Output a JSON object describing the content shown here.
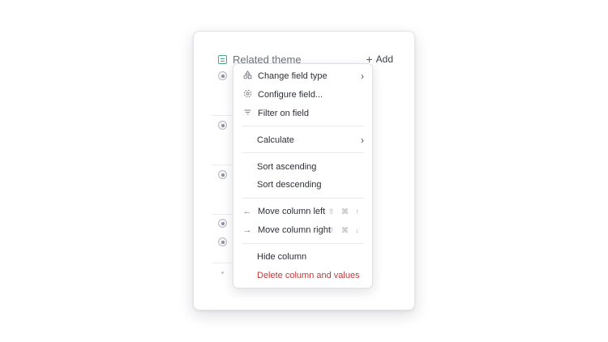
{
  "card": {
    "title": "Related theme",
    "add_label": "Add",
    "add_icon": "plus-icon",
    "title_icon": "list-icon",
    "accent": "#4aa88a"
  },
  "menu": {
    "items": [
      {
        "label": "Change field type",
        "icon": "shapes-icon",
        "submenu": true
      },
      {
        "label": "Configure field...",
        "icon": "gear-icon"
      },
      {
        "label": "Filter on field",
        "icon": "filter-icon"
      },
      {
        "label": "Calculate",
        "submenu": true
      },
      {
        "label": "Sort ascending"
      },
      {
        "label": "Sort descending"
      },
      {
        "label": "Move column left",
        "icon": "arrow-left-icon",
        "shortcut": "⇧ ⌘ ↑"
      },
      {
        "label": "Move column right",
        "icon": "arrow-right-icon",
        "shortcut": "⇧ ⌘ ↓"
      },
      {
        "label": "Hide column"
      },
      {
        "label": "Delete column and values",
        "danger": true,
        "color": "#c23a3a"
      }
    ]
  }
}
